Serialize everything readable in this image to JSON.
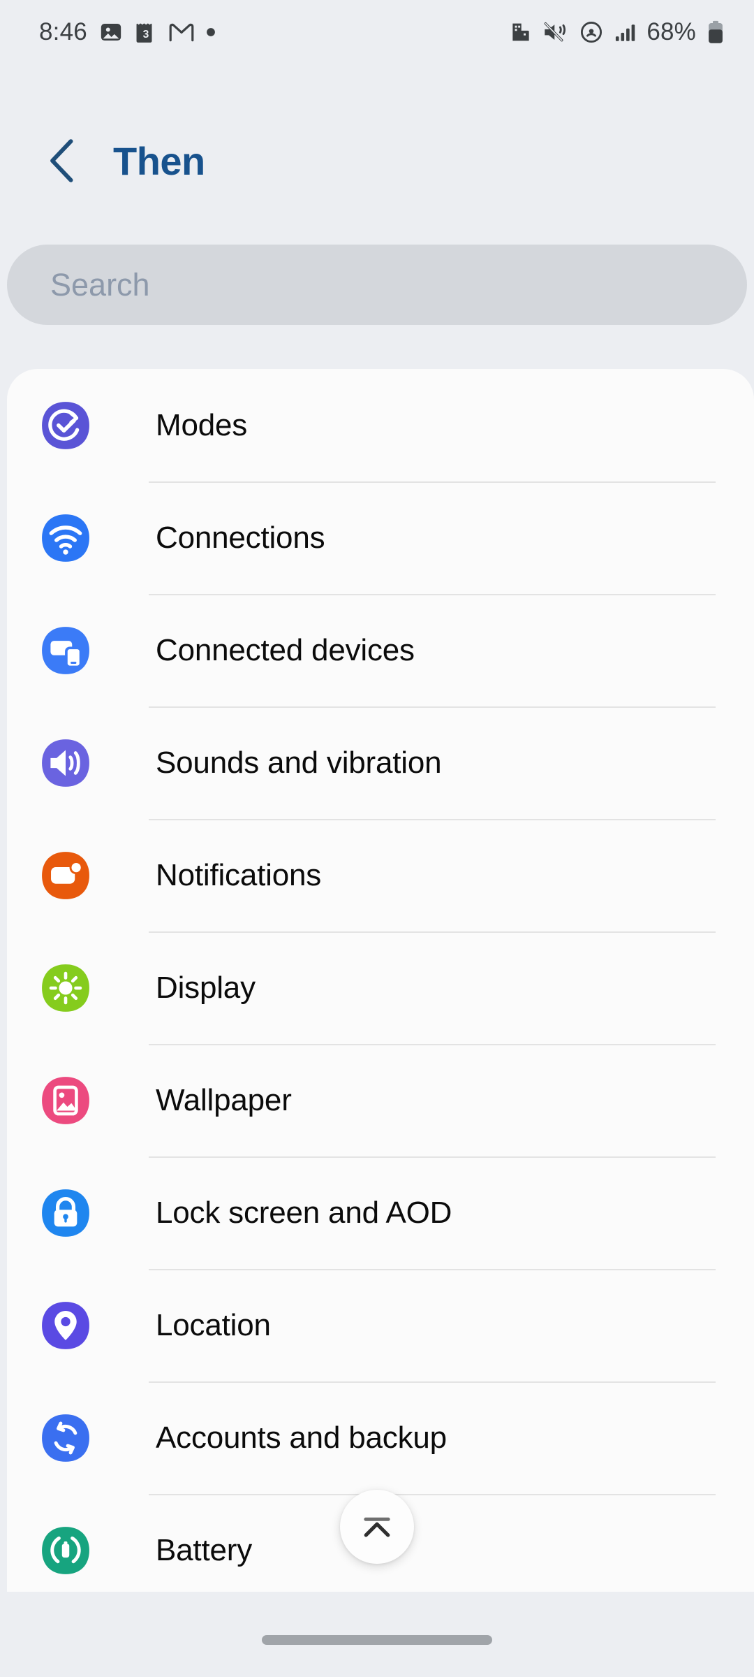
{
  "status_bar": {
    "time": "8:46",
    "left_icons": [
      "photos-icon",
      "calendar-3-icon",
      "gmail-icon",
      "dot-indicator-icon"
    ],
    "right_icons": [
      "app-icon",
      "mute-vibrate-icon",
      "hotspot-icon",
      "signal-bars-icon"
    ],
    "battery_percent": "68%",
    "battery_icon": "battery-icon"
  },
  "header": {
    "back_icon": "chevron-left-icon",
    "title": "Then",
    "title_color": "#18528d"
  },
  "search": {
    "placeholder": "Search",
    "value": "",
    "background": "#d4d7dc"
  },
  "settings_list": {
    "items": [
      {
        "label": "Modes",
        "icon": "modes-icon",
        "color": "#5a54d6"
      },
      {
        "label": "Connections",
        "icon": "wifi-icon",
        "color": "#2b76f5"
      },
      {
        "label": "Connected devices",
        "icon": "connected-devices-icon",
        "color": "#3b7bf7"
      },
      {
        "label": "Sounds and vibration",
        "icon": "volume-icon",
        "color": "#6a63e0"
      },
      {
        "label": "Notifications",
        "icon": "notifications-icon",
        "color": "#e8590c"
      },
      {
        "label": "Display",
        "icon": "brightness-icon",
        "color": "#85cc1d"
      },
      {
        "label": "Wallpaper",
        "icon": "image-icon",
        "color": "#ec4a7f"
      },
      {
        "label": "Lock screen and AOD",
        "icon": "lock-icon",
        "color": "#1f86ef"
      },
      {
        "label": "Location",
        "icon": "location-pin-icon",
        "color": "#5a4ae3"
      },
      {
        "label": "Accounts and backup",
        "icon": "sync-icon",
        "color": "#3a6ff0"
      },
      {
        "label": "Battery",
        "icon": "battery-circle-icon",
        "color": "#17a47f"
      }
    ]
  },
  "fab": {
    "icon": "scroll-to-top-icon",
    "label": "Scroll to top"
  },
  "navigation": {
    "gesture_handle": "gesture-handle"
  }
}
